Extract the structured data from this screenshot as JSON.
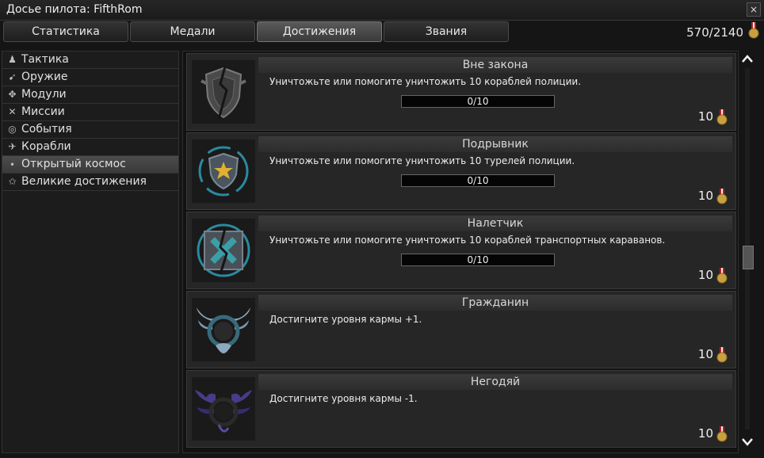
{
  "window": {
    "title": "Досье пилота: FifthRom",
    "close_icon": "×"
  },
  "tabs": [
    {
      "label": "Статистика"
    },
    {
      "label": "Медали"
    },
    {
      "label": "Достижения"
    },
    {
      "label": "Звания"
    }
  ],
  "active_tab": "Достижения",
  "points": "570/2140",
  "sidebar": {
    "items": [
      {
        "label": "Тактика",
        "icon": "tactics-icon"
      },
      {
        "label": "Оружие",
        "icon": "weapon-icon"
      },
      {
        "label": "Модули",
        "icon": "modules-icon"
      },
      {
        "label": "Миссии",
        "icon": "missions-icon"
      },
      {
        "label": "События",
        "icon": "events-icon"
      },
      {
        "label": "Корабли",
        "icon": "ships-icon"
      },
      {
        "label": "Открытый космос",
        "icon": "open-space-icon"
      },
      {
        "label": "Великие достижения",
        "icon": "star-icon"
      }
    ],
    "active": "Открытый космос"
  },
  "achievements": [
    {
      "title": "Вне закона",
      "description": "Уничтожьте или помогите уничтожить 10 кораблей полиции.",
      "progress": "0/10",
      "progress_value": 0,
      "reward": "10",
      "icon": "outlaw-shield-icon"
    },
    {
      "title": "Подрывник",
      "description": "Уничтожьте или помогите уничтожить 10 турелей полиции.",
      "progress": "0/10",
      "progress_value": 0,
      "reward": "10",
      "icon": "saboteur-star-icon"
    },
    {
      "title": "Налетчик",
      "description": "Уничтожьте или помогите уничтожить 10 кораблей транспортных караванов.",
      "progress": "0/10",
      "progress_value": 0,
      "reward": "10",
      "icon": "raider-cross-icon"
    },
    {
      "title": "Гражданин",
      "description": "Достигните уровня кармы +1.",
      "progress": "",
      "reward": "10",
      "icon": "citizen-wings-icon"
    },
    {
      "title": "Негодяй",
      "description": "Достигните уровня кармы -1.",
      "progress": "",
      "reward": "10",
      "icon": "scoundrel-wings-icon"
    }
  ],
  "colors": {
    "accent_medal": "#c8a040",
    "ribbon": "#b82020"
  }
}
